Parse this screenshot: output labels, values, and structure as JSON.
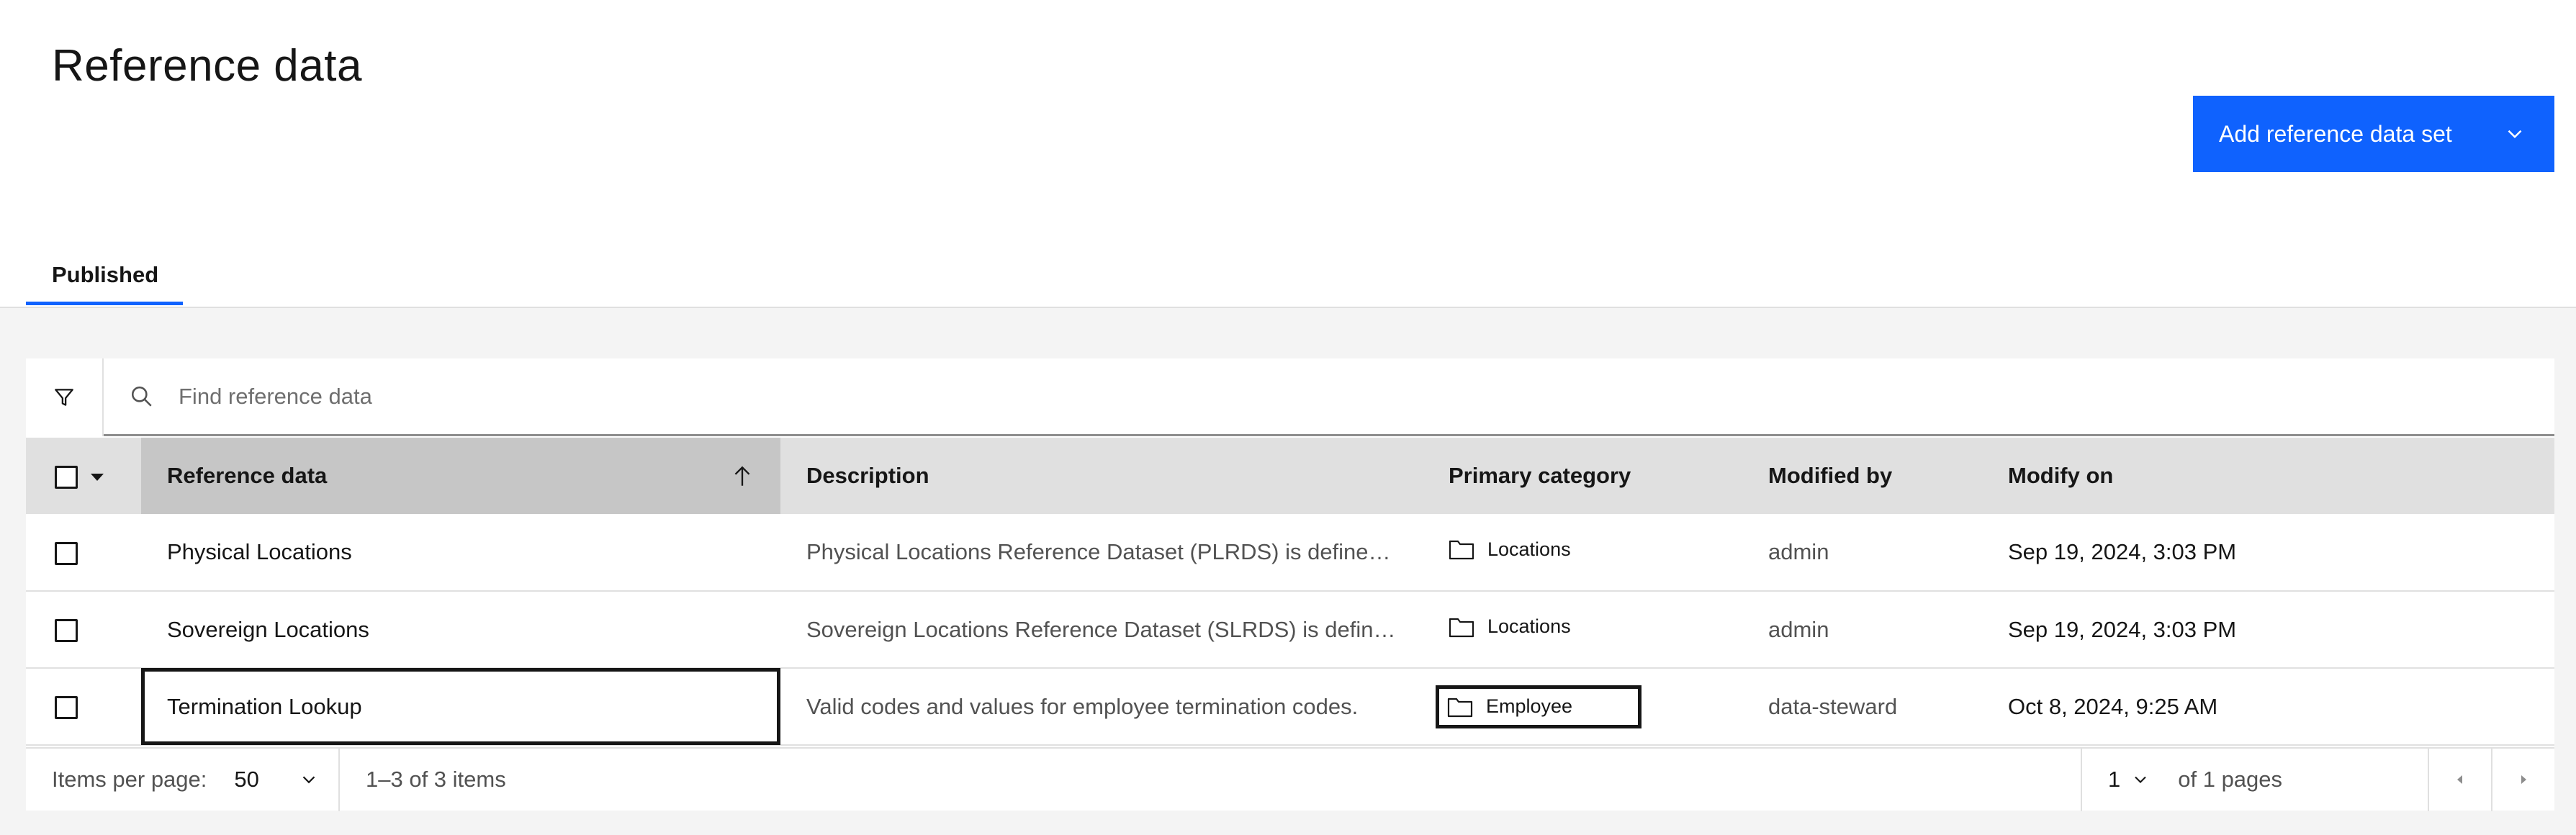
{
  "header": {
    "title": "Reference data",
    "add_button_label": "Add reference data set"
  },
  "tabs": [
    {
      "label": "Published",
      "selected": true
    }
  ],
  "search": {
    "placeholder": "Find reference data"
  },
  "table": {
    "columns": [
      "Reference data",
      "Description",
      "Primary category",
      "Modified by",
      "Modify on"
    ],
    "sort": {
      "column": "Reference data",
      "direction": "ascending"
    },
    "rows": [
      {
        "name": "Physical Locations",
        "description": "Physical Locations Reference Dataset (PLRDS) is define…",
        "category": "Locations",
        "modified_by": "admin",
        "modified_on": "Sep 19, 2024, 3:03 PM"
      },
      {
        "name": "Sovereign Locations",
        "description": "Sovereign Locations Reference Dataset (SLRDS) is defin…",
        "category": "Locations",
        "modified_by": "admin",
        "modified_on": "Sep 19, 2024, 3:03 PM"
      },
      {
        "name": "Termination Lookup",
        "description": "Valid codes and values for employee termination codes.",
        "category": "Employee",
        "modified_by": "data-steward",
        "modified_on": "Oct 8, 2024, 9:25 AM"
      }
    ]
  },
  "pagination": {
    "items_per_page_label": "Items per page:",
    "items_per_page": "50",
    "range_text": "1–3 of 3 items",
    "current_page": "1",
    "of_pages_text": "of 1 pages"
  },
  "colors": {
    "primary": "#0f62fe",
    "header_bg": "#e0e0e0",
    "sorted_header_bg": "#c6c6c6",
    "page_bg": "#f4f4f4"
  }
}
